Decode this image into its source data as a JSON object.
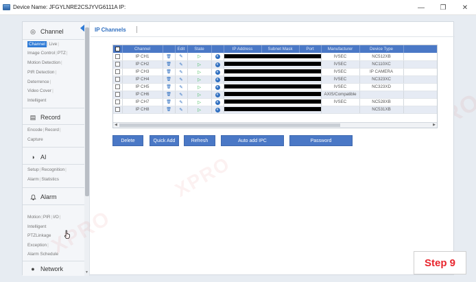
{
  "window": {
    "title": "Device Name: JFGYLNRE2CSJYVG6111A  IP:",
    "controls": {
      "minimize": "—",
      "maximize": "❐",
      "close": "✕"
    }
  },
  "sidebar": {
    "sections": [
      {
        "title": "Channel",
        "icon": "target-icon",
        "glyph": "◎"
      },
      {
        "title": "Record",
        "icon": "record-icon",
        "glyph": "▤"
      },
      {
        "title": "AI",
        "icon": "ai-icon",
        "glyph": "◑"
      },
      {
        "title": "Alarm",
        "icon": "bell-icon",
        "glyph": "🔔"
      },
      {
        "title": "Network",
        "icon": "network-icon",
        "glyph": "●"
      }
    ],
    "channel_items": {
      "row1": [
        "Channel",
        "Live"
      ],
      "row2": [
        "Image Control",
        "PTZ"
      ],
      "row3": [
        "Motion Detection"
      ],
      "row4": [
        "PIR Detection"
      ],
      "row5": [
        "Deterrence"
      ],
      "row6": [
        "Video Cover"
      ],
      "row7": [
        "Intelligent"
      ]
    },
    "record_items": {
      "row1": [
        "Encode",
        "Record"
      ],
      "row2": [
        "Capture"
      ]
    },
    "ai_items": {
      "row1": [
        "Setup",
        "Recognition"
      ],
      "row2": [
        "Alarm",
        "Statistics"
      ]
    },
    "alarm_items": {
      "row1": [
        "Motion",
        "PIR",
        "I/O"
      ],
      "row2": [
        "Intelligent"
      ],
      "row3": [
        "PTZLinkage"
      ],
      "row4": [
        "Exception"
      ],
      "row5": [
        "Alarm Schedule"
      ]
    }
  },
  "main": {
    "tab": "IP Channels",
    "table": {
      "columns": [
        "Channel",
        "Edit",
        "State",
        "IP Address",
        "Subnet Mask",
        "Port",
        "Manufacturer",
        "Device Type"
      ],
      "rows": [
        {
          "channel": "IP CH1",
          "manufacturer": "IVSEC",
          "device_type": "NC512XB"
        },
        {
          "channel": "IP CH2",
          "manufacturer": "IVSEC",
          "device_type": "NC110XC"
        },
        {
          "channel": "IP CH3",
          "manufacturer": "IVSEC",
          "device_type": "IP CAMERA"
        },
        {
          "channel": "IP CH4",
          "manufacturer": "IVSEC",
          "device_type": "NC323XC"
        },
        {
          "channel": "IP CH5",
          "manufacturer": "IVSEC",
          "device_type": "NC323XD"
        },
        {
          "channel": "IP CH6",
          "manufacturer": "AXIS/Compatible",
          "device_type": ""
        },
        {
          "channel": "IP CH7",
          "manufacturer": "IVSEC",
          "device_type": "NC528XB"
        },
        {
          "channel": "IP CH8",
          "manufacturer": "",
          "device_type": "NC531XB"
        }
      ]
    },
    "buttons": {
      "delete": "Delete",
      "quick_add": "Quick Add",
      "refresh": "Refresh",
      "auto_add": "Auto add IPC",
      "password": "Password"
    }
  },
  "step_label": "Step 9",
  "colors": {
    "accent": "#2f7bd6",
    "header": "#4a78c6",
    "step": "#e8252d",
    "state_play": "#2fb24a"
  }
}
